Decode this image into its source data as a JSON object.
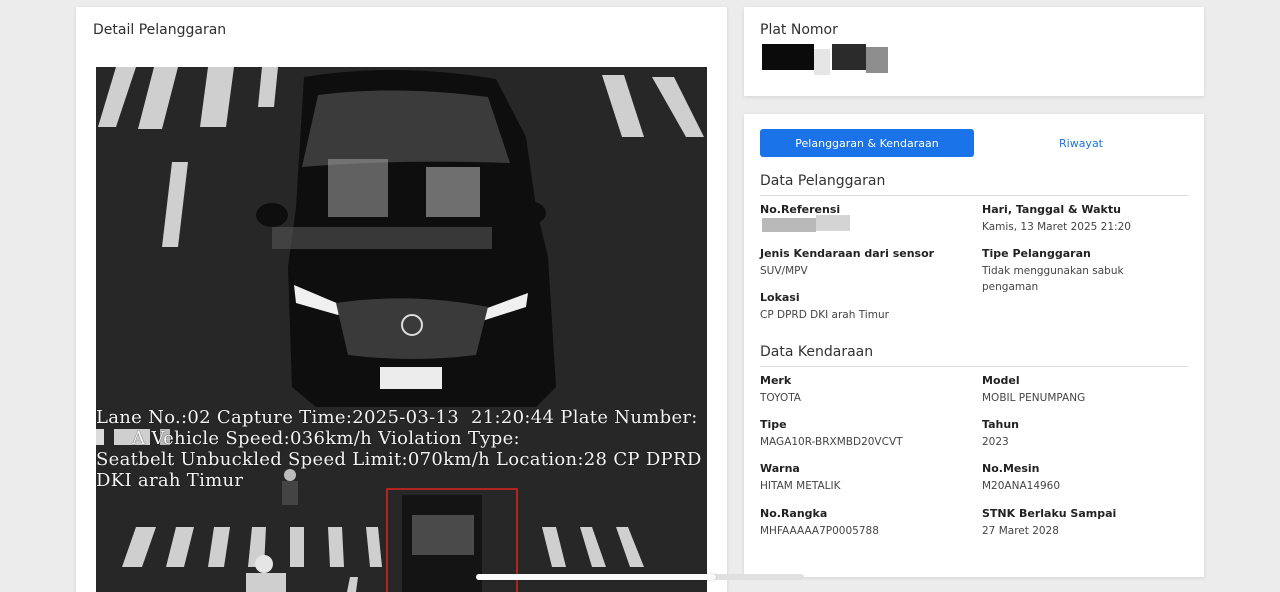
{
  "detail": {
    "title": "Detail Pelanggaran",
    "camera_overlay": {
      "line1": "Lane No.:02 Capture Time:2025-03-13  21:20:44 Plate Number:",
      "line2": "      A Vehicle Speed:036km/h Violation Type:",
      "line3": "Seatbelt Unbuckled Speed Limit:070km/h Location:28 CP DPRD",
      "line4": "DKI arah Timur"
    }
  },
  "plate": {
    "title": "Plat Nomor"
  },
  "tabs": [
    {
      "label": "Pelanggaran & Kendaraan",
      "active": true
    },
    {
      "label": "Riwayat",
      "active": false
    }
  ],
  "pelanggaran": {
    "title": "Data Pelanggaran",
    "fields": [
      {
        "label": "No.Referensi",
        "value": ""
      },
      {
        "label": "Hari, Tanggal & Waktu",
        "value": "Kamis, 13 Maret 2025 21:20"
      },
      {
        "label": "Jenis Kendaraan dari sensor",
        "value": "SUV/MPV"
      },
      {
        "label": "Tipe Pelanggaran",
        "value": "Tidak menggunakan sabuk pengaman"
      },
      {
        "label": "Lokasi",
        "value": "CP DPRD DKI arah Timur"
      }
    ]
  },
  "kendaraan": {
    "title": "Data Kendaraan",
    "fields": [
      {
        "label": "Merk",
        "value": "TOYOTA"
      },
      {
        "label": "Model",
        "value": "MOBIL PENUMPANG"
      },
      {
        "label": "Tipe",
        "value": "MAGA10R-BRXMBD20VCVT"
      },
      {
        "label": "Tahun",
        "value": "2023"
      },
      {
        "label": "Warna",
        "value": "HITAM METALIK"
      },
      {
        "label": "No.Mesin",
        "value": "M20ANA14960"
      },
      {
        "label": "No.Rangka",
        "value": "MHFAAAAA7P0005788"
      },
      {
        "label": "STNK Berlaku Sampai",
        "value": "27 Maret 2028"
      }
    ]
  },
  "colors": {
    "accent": "#1a73e8",
    "violation_box": "#e0231c"
  }
}
